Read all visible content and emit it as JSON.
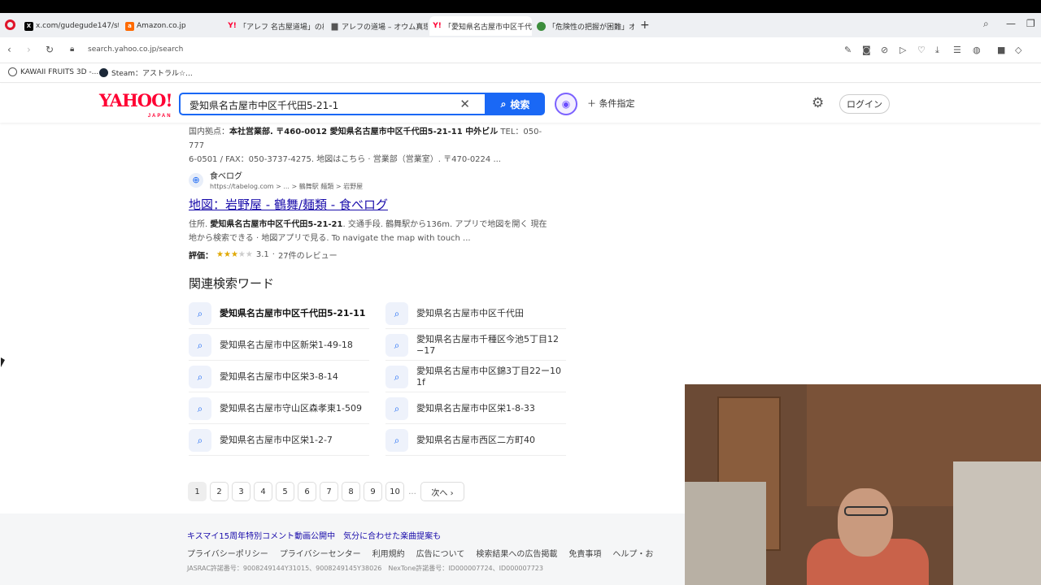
{
  "browser": {
    "tabs": [
      {
        "label": "x.com/gudegude147/stat",
        "icon": "x-icon",
        "color": "#000000"
      },
      {
        "label": "Amazon.co.jp",
        "icon": "amazon-icon",
        "color": "#ff9900"
      },
      {
        "label": "「アレフ 名古屋道場」の検索",
        "icon": "yahoo-icon",
        "color": "#ff0033"
      },
      {
        "label": "アレフの道場 – オウム真理教",
        "icon": "doc-icon",
        "color": "#555555"
      },
      {
        "label": "「愛知県名古屋市中区千代",
        "icon": "yahoo-icon",
        "color": "#ff0033"
      },
      {
        "label": "「危険性の把握が困難」オウ",
        "icon": "globe-icon",
        "color": "#3c8d3c"
      }
    ],
    "url": "search.yahoo.co.jp/search",
    "bookmarks": [
      {
        "label": "KAWAII FRUITS 3D -...",
        "icon": "kawaii-icon"
      },
      {
        "label": "Steam：アストラル☆...",
        "icon": "steam-icon"
      }
    ]
  },
  "yahoo": {
    "logo": "YAHOO!",
    "logo_sub": "JAPAN",
    "query": "愛知県名古屋市中区千代田5-21-1",
    "search_button": "検索",
    "conditions": "条件指定",
    "login": "ログイン"
  },
  "snippet_top": {
    "line1_prefix": "国内拠点：",
    "line1_bold": "本社営業部. 〒460-0012 愛知県名古屋市中区千代田5-21-11 中外ビル",
    "line1_suffix": "TEL：050-777",
    "line2": "6-0501 / FAX：050-3737-4275. 地図はこちら · 営業部（営業室）. 〒470-0224 ..."
  },
  "result": {
    "site_name": "食べログ",
    "site_url": "https://tabelog.com > ... > 鶴舞駅 麺類 > 岩野屋",
    "title": "地図：岩野屋 - 鶴舞/麺類 - 食べログ",
    "desc_prefix": "住所.",
    "desc_bold": "愛知県名古屋市中区千代田5-21-21",
    "desc_rest": ". 交通手段. 鶴舞駅から136m. アプリで地図を開く 現在",
    "desc_line2": "地から検索できる · 地図アプリで見る. To navigate the map with touch ...",
    "rating_label": "評価：",
    "rating_value": "3.1",
    "rating_stars": 3,
    "reviews": "27件のレビュー"
  },
  "related": {
    "title": "関連検索ワード",
    "items": [
      {
        "text": "愛知県名古屋市中区千代田5-21-11",
        "bold": true
      },
      {
        "text": "愛知県名古屋市中区千代田",
        "bold": false
      },
      {
        "text": "愛知県名古屋市中区新栄1-49-18",
        "bold": false
      },
      {
        "text": "愛知県名古屋市千種区今池5丁目12−17",
        "bold": false
      },
      {
        "text": "愛知県名古屋市中区栄3-8-14",
        "bold": false
      },
      {
        "text": "愛知県名古屋市中区錦3丁目22ー10 1f",
        "bold": false
      },
      {
        "text": "愛知県名古屋市守山区森孝東1-509",
        "bold": false
      },
      {
        "text": "愛知県名古屋市中区栄1-8-33",
        "bold": false
      },
      {
        "text": "愛知県名古屋市中区栄1-2-7",
        "bold": false
      },
      {
        "text": "愛知県名古屋市西区二方町40",
        "bold": false
      }
    ]
  },
  "pagination": {
    "pages": [
      "1",
      "2",
      "3",
      "4",
      "5",
      "6",
      "7",
      "8",
      "9",
      "10"
    ],
    "current": "1",
    "dots": "...",
    "next": "次へ"
  },
  "footer": {
    "links1": [
      "キスマイ15周年特別コメント動画公開中",
      "気分に合わせた楽曲提案も"
    ],
    "links2": [
      "プライバシーポリシー",
      "プライバシーセンター",
      "利用規約",
      "広告について",
      "検索結果への広告掲載",
      "免責事項",
      "ヘルプ・お"
    ],
    "license": "JASRAC許諾番号：9008249144Y31015、9008249145Y38026　NexTone許諾番号：ID000007724、ID000007723"
  }
}
